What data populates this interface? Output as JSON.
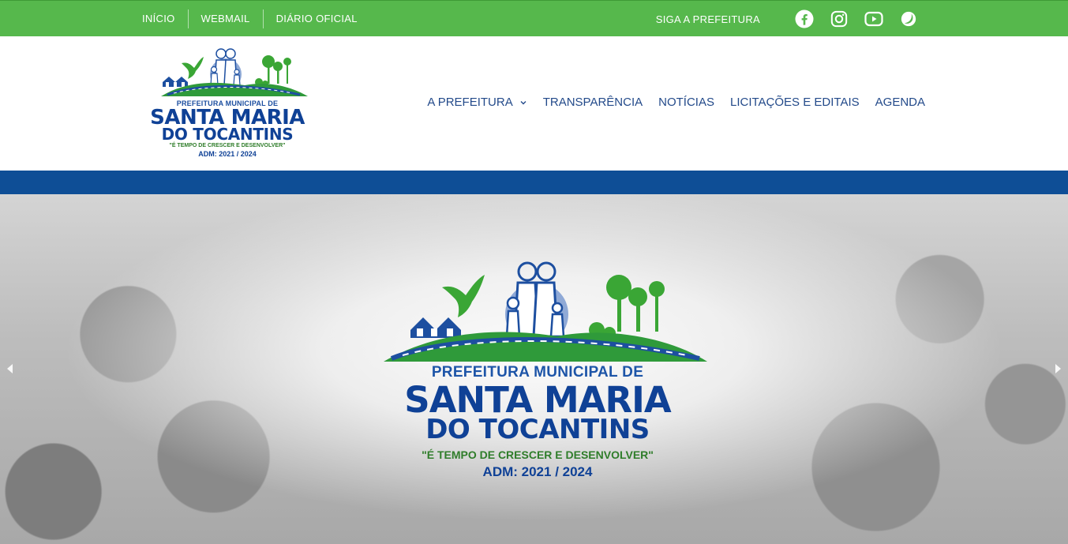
{
  "topbar": {
    "links": [
      "INÍCIO",
      "WEBMAIL",
      "DIÁRIO OFICIAL"
    ],
    "follow_label": "SIGA A PREFEITURA",
    "icons": [
      "facebook-icon",
      "instagram-icon",
      "youtube-icon",
      "contrast-icon"
    ]
  },
  "header": {
    "logo": {
      "line1": "PREFEITURA MUNICIPAL DE",
      "line2": "SANTA MARIA",
      "line3": "DO TOCANTINS",
      "slogan": "\"É TEMPO DE CRESCER E DESENVOLVER\"",
      "adm": "ADM: 2021 / 2024"
    },
    "nav": [
      {
        "label": "A PREFEITURA",
        "has_dropdown": true
      },
      {
        "label": "TRANSPARÊNCIA",
        "has_dropdown": false
      },
      {
        "label": "NOTÍCIAS",
        "has_dropdown": false
      },
      {
        "label": "LICITAÇÕES E EDITAIS",
        "has_dropdown": false
      },
      {
        "label": "AGENDA",
        "has_dropdown": false
      }
    ]
  },
  "hero": {
    "line1": "PREFEITURA MUNICIPAL DE",
    "line2": "SANTA MARIA",
    "line3": "DO TOCANTINS",
    "slogan": "\"É TEMPO DE CRESCER E DESENVOLVER\"",
    "adm": "ADM: 2021 / 2024"
  },
  "colors": {
    "topbar": "#56b84c",
    "brand_blue": "#0f4196",
    "band_blue": "#0e4e96",
    "brand_green": "#2f9a3a"
  }
}
